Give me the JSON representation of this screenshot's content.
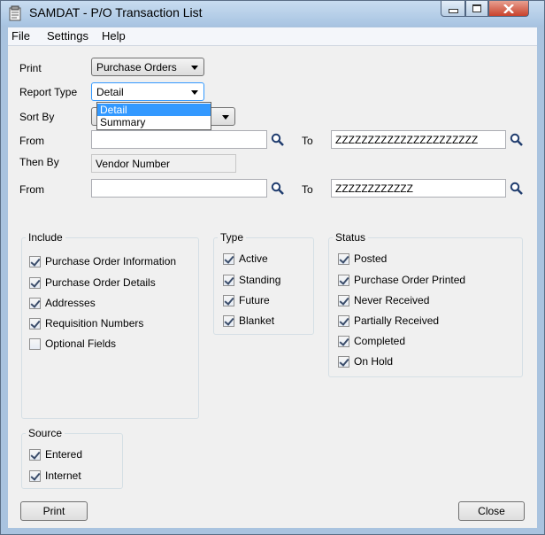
{
  "window": {
    "title": "SAMDAT - P/O Transaction List"
  },
  "menu": {
    "items": [
      "File",
      "Settings",
      "Help"
    ]
  },
  "form": {
    "print_label": "Print",
    "print_value": "Purchase Orders",
    "report_type_label": "Report Type",
    "report_type_value": "Detail",
    "report_type_options": [
      "Detail",
      "Summary"
    ],
    "report_type_highlighted": "Detail",
    "sort_by_label": "Sort By",
    "from_label": "From",
    "to_label": "To",
    "from1_value": "",
    "to1_value": "ZZZZZZZZZZZZZZZZZZZZZZ",
    "then_by_label": "Then By",
    "then_by_value": "Vendor Number",
    "from2_value": "",
    "to2_value": "ZZZZZZZZZZZZ"
  },
  "include": {
    "title": "Include",
    "items": [
      {
        "label": "Purchase Order Information",
        "checked": true
      },
      {
        "label": "Purchase Order Details",
        "checked": true
      },
      {
        "label": "Addresses",
        "checked": true
      },
      {
        "label": "Requisition Numbers",
        "checked": true
      },
      {
        "label": "Optional Fields",
        "checked": false
      }
    ]
  },
  "type": {
    "title": "Type",
    "items": [
      {
        "label": "Active",
        "checked": true
      },
      {
        "label": "Standing",
        "checked": true
      },
      {
        "label": "Future",
        "checked": true
      },
      {
        "label": "Blanket",
        "checked": true
      }
    ]
  },
  "status": {
    "title": "Status",
    "items": [
      {
        "label": "Posted",
        "checked": true
      },
      {
        "label": "Purchase Order Printed",
        "checked": true
      },
      {
        "label": "Never Received",
        "checked": true
      },
      {
        "label": "Partially Received",
        "checked": true
      },
      {
        "label": "Completed",
        "checked": true
      },
      {
        "label": "On Hold",
        "checked": true
      }
    ]
  },
  "source": {
    "title": "Source",
    "items": [
      {
        "label": "Entered",
        "checked": true
      },
      {
        "label": "Internet",
        "checked": true
      }
    ]
  },
  "buttons": {
    "print": "Print",
    "close": "Close"
  },
  "icons": {
    "finder": "magnifier-icon",
    "app": "app-icon"
  }
}
